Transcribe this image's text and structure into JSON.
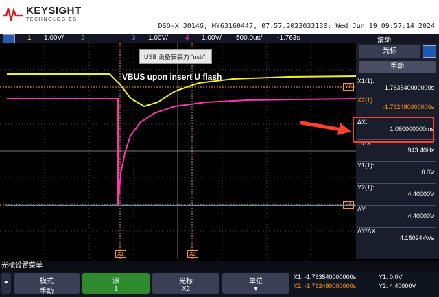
{
  "header": {
    "brand": "KEYSIGHT",
    "brand_sub": "TECHNOLOGIES",
    "model_info": "DSO-X 3014G, MY63160447, 07.57.2023033130: Wed Jun 19 09:57:14 2024"
  },
  "channel_bar": {
    "ch1_num": "1",
    "ch1_scale": "1.00V/",
    "ch2_num": "2",
    "ch3_num": "3",
    "ch3_scale": "1.00V/",
    "ch4_num": "4",
    "ch4_scale": "1.00V/",
    "timebase": "500.0us/",
    "delay": "-1.763s",
    "trigger_mode": "滚动"
  },
  "screen": {
    "tooltip": "USB 设备安装为 “usb”.",
    "annotation": "VBUS upon insert U flash",
    "marker_y2": "Y2",
    "marker_y1": "Y1",
    "marker_x1": "X1",
    "marker_x2": "X2"
  },
  "side_panel": {
    "title": "光标",
    "mode_button": "手动",
    "x1_label": "X1(1):",
    "x1_value": "-1.763540000000s",
    "x2_label": "X2(1):",
    "x2_value": "-1.762480000000s",
    "dx_label": "ΔX:",
    "dx_value": "1.060000000ms",
    "inv_dx_label": "1/ΔX:",
    "inv_dx_value": "943.40Hz",
    "y1_label": "Y1(1):",
    "y1_value": "0.0V",
    "y2_label": "Y2(1):",
    "y2_value": "4.40000V",
    "dy_label": "ΔY:",
    "dy_value": "4.40000V",
    "dydx_label": "ΔY/ΔX:",
    "dydx_value": "4.15094kV/s"
  },
  "status_line": "光标设置菜单",
  "softkeys": {
    "mode_label": "模式",
    "mode_value": "手动",
    "source_label": "源",
    "source_value": "1",
    "cursors_label": "光标",
    "cursors_value": "X2",
    "units_label": "单位"
  },
  "readout": {
    "x1": "X1: -1.763540000000s",
    "x2": "X2: -1.762480000000s",
    "y1": "Y1: 0.0V",
    "y2": "Y2: 4.40000V"
  },
  "colors": {
    "ch1": "#f2f215",
    "ch2": "#33dd33",
    "ch3": "#4a7dff",
    "ch4": "#ff33bb",
    "cursor": "#ff9a10",
    "highlight": "#ff4030"
  }
}
